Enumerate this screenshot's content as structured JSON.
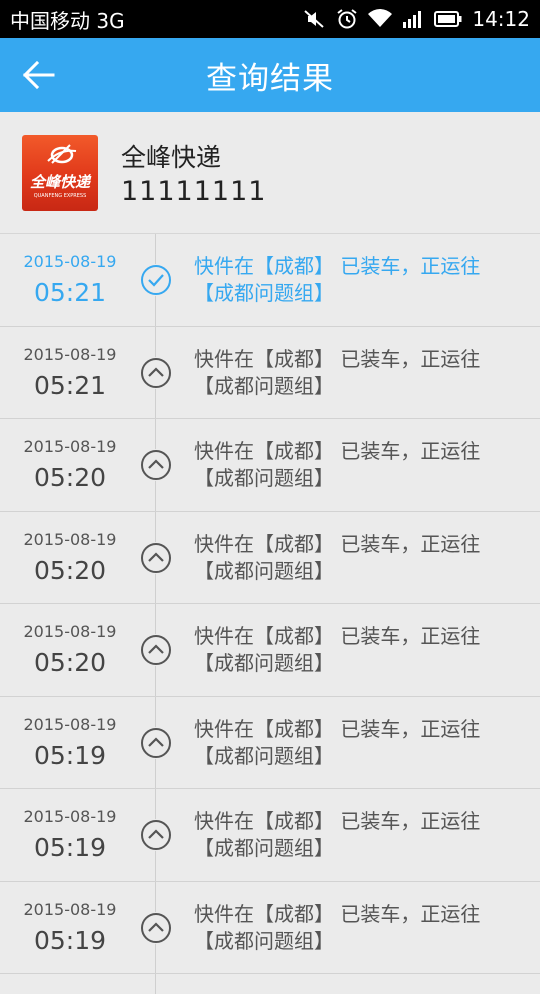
{
  "status_bar": {
    "carrier": "中国移动 3G",
    "time": "14:12"
  },
  "app_bar": {
    "title": "查询结果"
  },
  "company": {
    "name": "全峰快递",
    "tracking_number": "11111111",
    "logo_text": "全峰快递",
    "logo_subtext": "QUANFENG EXPRESS"
  },
  "colors": {
    "accent": "#36a8f0",
    "logo_red": "#e0381a"
  },
  "tracking_events": [
    {
      "date": "2015-08-19",
      "time": "05:21",
      "desc": "快件在【成都】 已装车，正运往【成都问题组】",
      "status": "check-circle-icon"
    },
    {
      "date": "2015-08-19",
      "time": "05:21",
      "desc": "快件在【成都】 已装车，正运往【成都问题组】",
      "status": "chevron-up-circle-icon"
    },
    {
      "date": "2015-08-19",
      "time": "05:20",
      "desc": "快件在【成都】 已装车，正运往【成都问题组】",
      "status": "chevron-up-circle-icon"
    },
    {
      "date": "2015-08-19",
      "time": "05:20",
      "desc": "快件在【成都】 已装车，正运往【成都问题组】",
      "status": "chevron-up-circle-icon"
    },
    {
      "date": "2015-08-19",
      "time": "05:20",
      "desc": "快件在【成都】 已装车，正运往【成都问题组】",
      "status": "chevron-up-circle-icon"
    },
    {
      "date": "2015-08-19",
      "time": "05:19",
      "desc": "快件在【成都】 已装车，正运往【成都问题组】",
      "status": "chevron-up-circle-icon"
    },
    {
      "date": "2015-08-19",
      "time": "05:19",
      "desc": "快件在【成都】 已装车，正运往【成都问题组】",
      "status": "chevron-up-circle-icon"
    },
    {
      "date": "2015-08-19",
      "time": "05:19",
      "desc": "快件在【成都】 已装车，正运往【成都问题组】",
      "status": "chevron-up-circle-icon"
    }
  ]
}
